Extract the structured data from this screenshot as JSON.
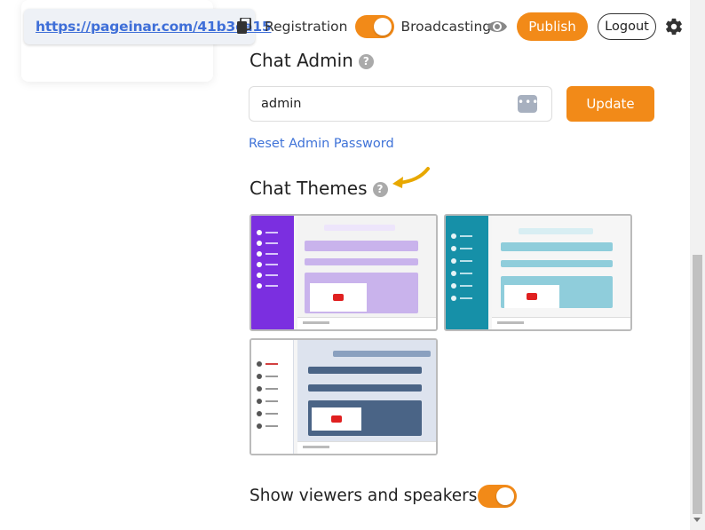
{
  "header": {
    "url": "https://pageinar.com/41b3ca15",
    "registration_label": "Registration",
    "broadcasting_label": "Broadcasting",
    "publish_label": "Publish",
    "logout_label": "Logout",
    "registration_on": true,
    "accent_color": "#f28a18"
  },
  "chat_admin": {
    "title": "Chat Admin",
    "help": "?",
    "input_value": "admin",
    "dots": "•••",
    "update_label": "Update",
    "reset_link": "Reset Admin Password"
  },
  "chat_themes": {
    "title": "Chat Themes",
    "help": "?",
    "themes": [
      {
        "id": "purple",
        "accent": "#7b2fe0",
        "selected": false
      },
      {
        "id": "teal",
        "accent": "#1690a8",
        "selected": false
      },
      {
        "id": "slate",
        "accent": "#4a6486",
        "selected": false
      }
    ]
  },
  "viewers": {
    "label": "Show viewers and speakers",
    "enabled": true
  }
}
